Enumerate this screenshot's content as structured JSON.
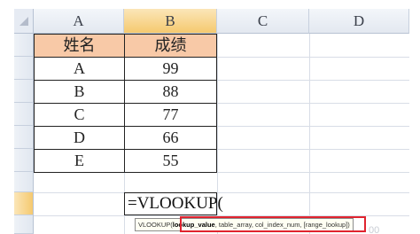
{
  "columns": [
    "A",
    "B",
    "C",
    "D"
  ],
  "table": {
    "headers": [
      "姓名",
      "成绩"
    ],
    "rows": [
      {
        "name": "A",
        "score": "99"
      },
      {
        "name": "B",
        "score": "88"
      },
      {
        "name": "C",
        "score": "77"
      },
      {
        "name": "D",
        "score": "66"
      },
      {
        "name": "E",
        "score": "55"
      }
    ]
  },
  "formula_input": "=VLOOKUP(",
  "tooltip": {
    "function": "VLOOKUP(",
    "active_arg": "lookup_value",
    "rest": ", table_array, col_index_num, [range_lookup])"
  },
  "faint_text": "00",
  "colors": {
    "header_fill": "#f8c9a7",
    "selected_header": "#f5c96f",
    "highlight_border": "#e0242f"
  }
}
